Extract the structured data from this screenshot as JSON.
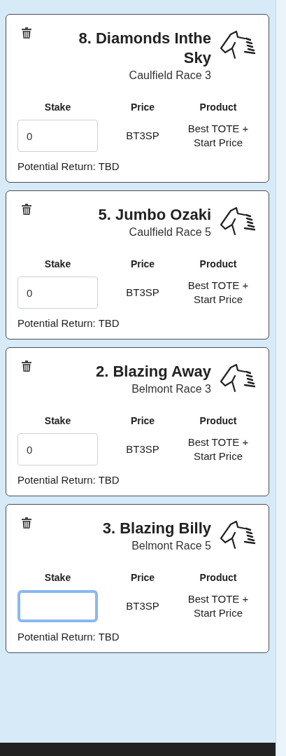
{
  "bets": [
    {
      "title": "8. Diamonds Inthe Sky",
      "race": "Caulfield Race 3",
      "columns": [
        "Stake",
        "Price",
        "Product"
      ],
      "product": "Best TOTE + Start Price",
      "price": "BT3SP",
      "stake": {
        "value": "0",
        "focused": false
      },
      "potential_return": "Potential Return: TBD"
    },
    {
      "title": "5. Jumbo Ozaki",
      "race": "Caulfield Race 5",
      "columns": [
        "Stake",
        "Price",
        "Product"
      ],
      "product": "Best TOTE + Start Price",
      "price": "BT3SP",
      "stake": {
        "value": "0",
        "focused": false
      },
      "potential_return": "Potential Return: TBD"
    },
    {
      "title": "2. Blazing Away",
      "race": "Belmont Race 3",
      "columns": [
        "Stake",
        "Price",
        "Product"
      ],
      "product": "Best TOTE + Start Price",
      "price": "BT3SP",
      "stake": {
        "value": "0",
        "focused": false
      },
      "potential_return": "Potential Return: TBD"
    },
    {
      "title": "3. Blazing Billy",
      "race": "Belmont Race 5",
      "columns": [
        "Stake",
        "Price",
        "Product"
      ],
      "product": "Best TOTE + Start Price",
      "price": "BT3SP",
      "stake": {
        "focused": true
      },
      "potential_return": "Potential Return: TBD"
    }
  ]
}
